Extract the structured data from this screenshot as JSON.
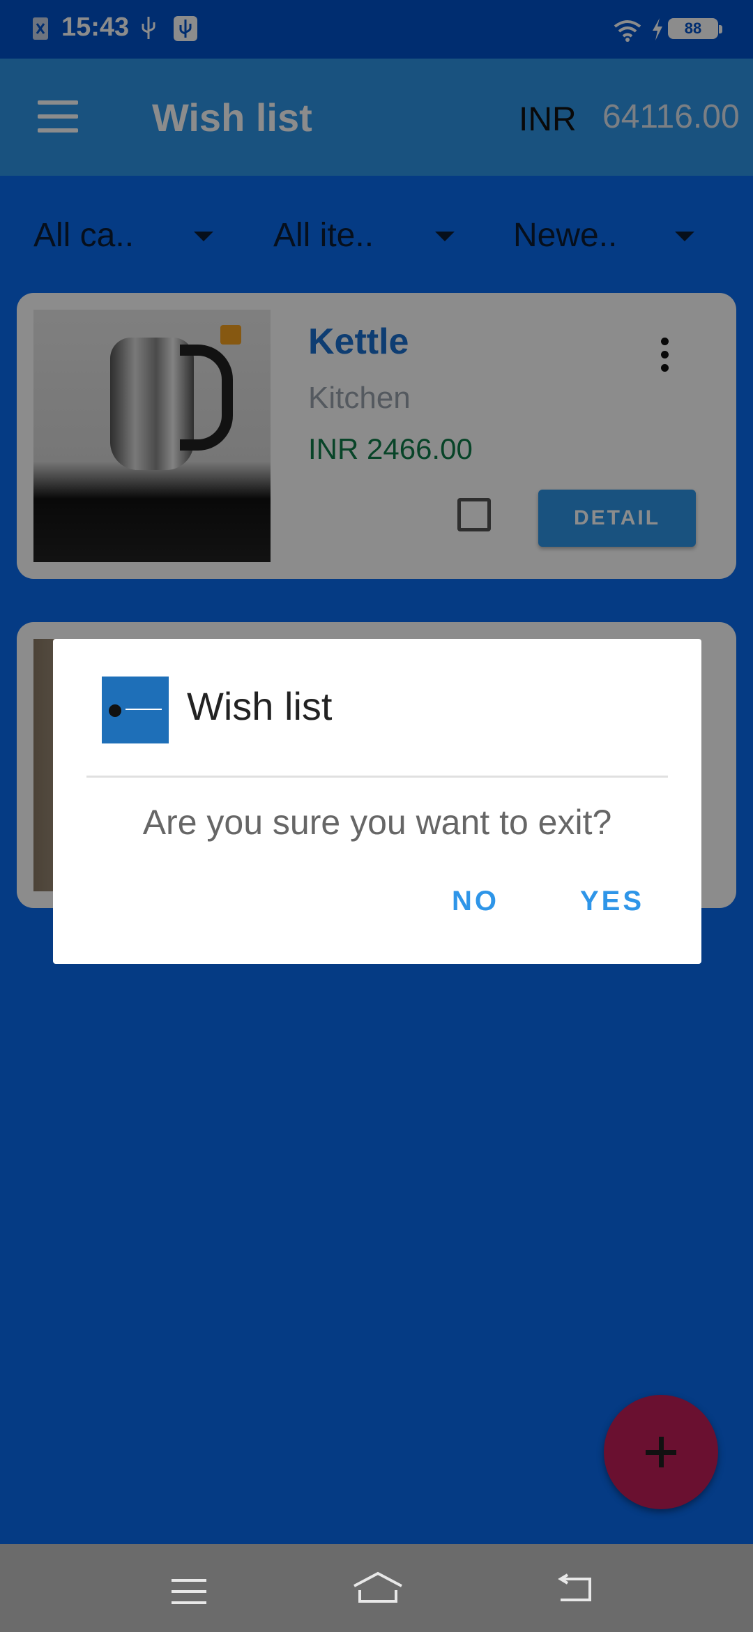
{
  "status_bar": {
    "time": "15:43",
    "battery": "88"
  },
  "app_bar": {
    "title": "Wish list",
    "currency": "INR",
    "balance": "64116.00"
  },
  "filters": [
    {
      "label": "All ca.."
    },
    {
      "label": "All ite.."
    },
    {
      "label": "Newe.."
    }
  ],
  "items": [
    {
      "title": "Kettle",
      "category": "Kitchen",
      "price": "INR 2466.00",
      "detail_label": "DETAIL"
    }
  ],
  "dialog": {
    "title": "Wish list",
    "message": "Are you sure you want to exit?",
    "no_label": "NO",
    "yes_label": "YES"
  },
  "colors": {
    "primary": "#2e95e8",
    "price_green": "#0f7d4a",
    "fab": "#c2185b"
  }
}
